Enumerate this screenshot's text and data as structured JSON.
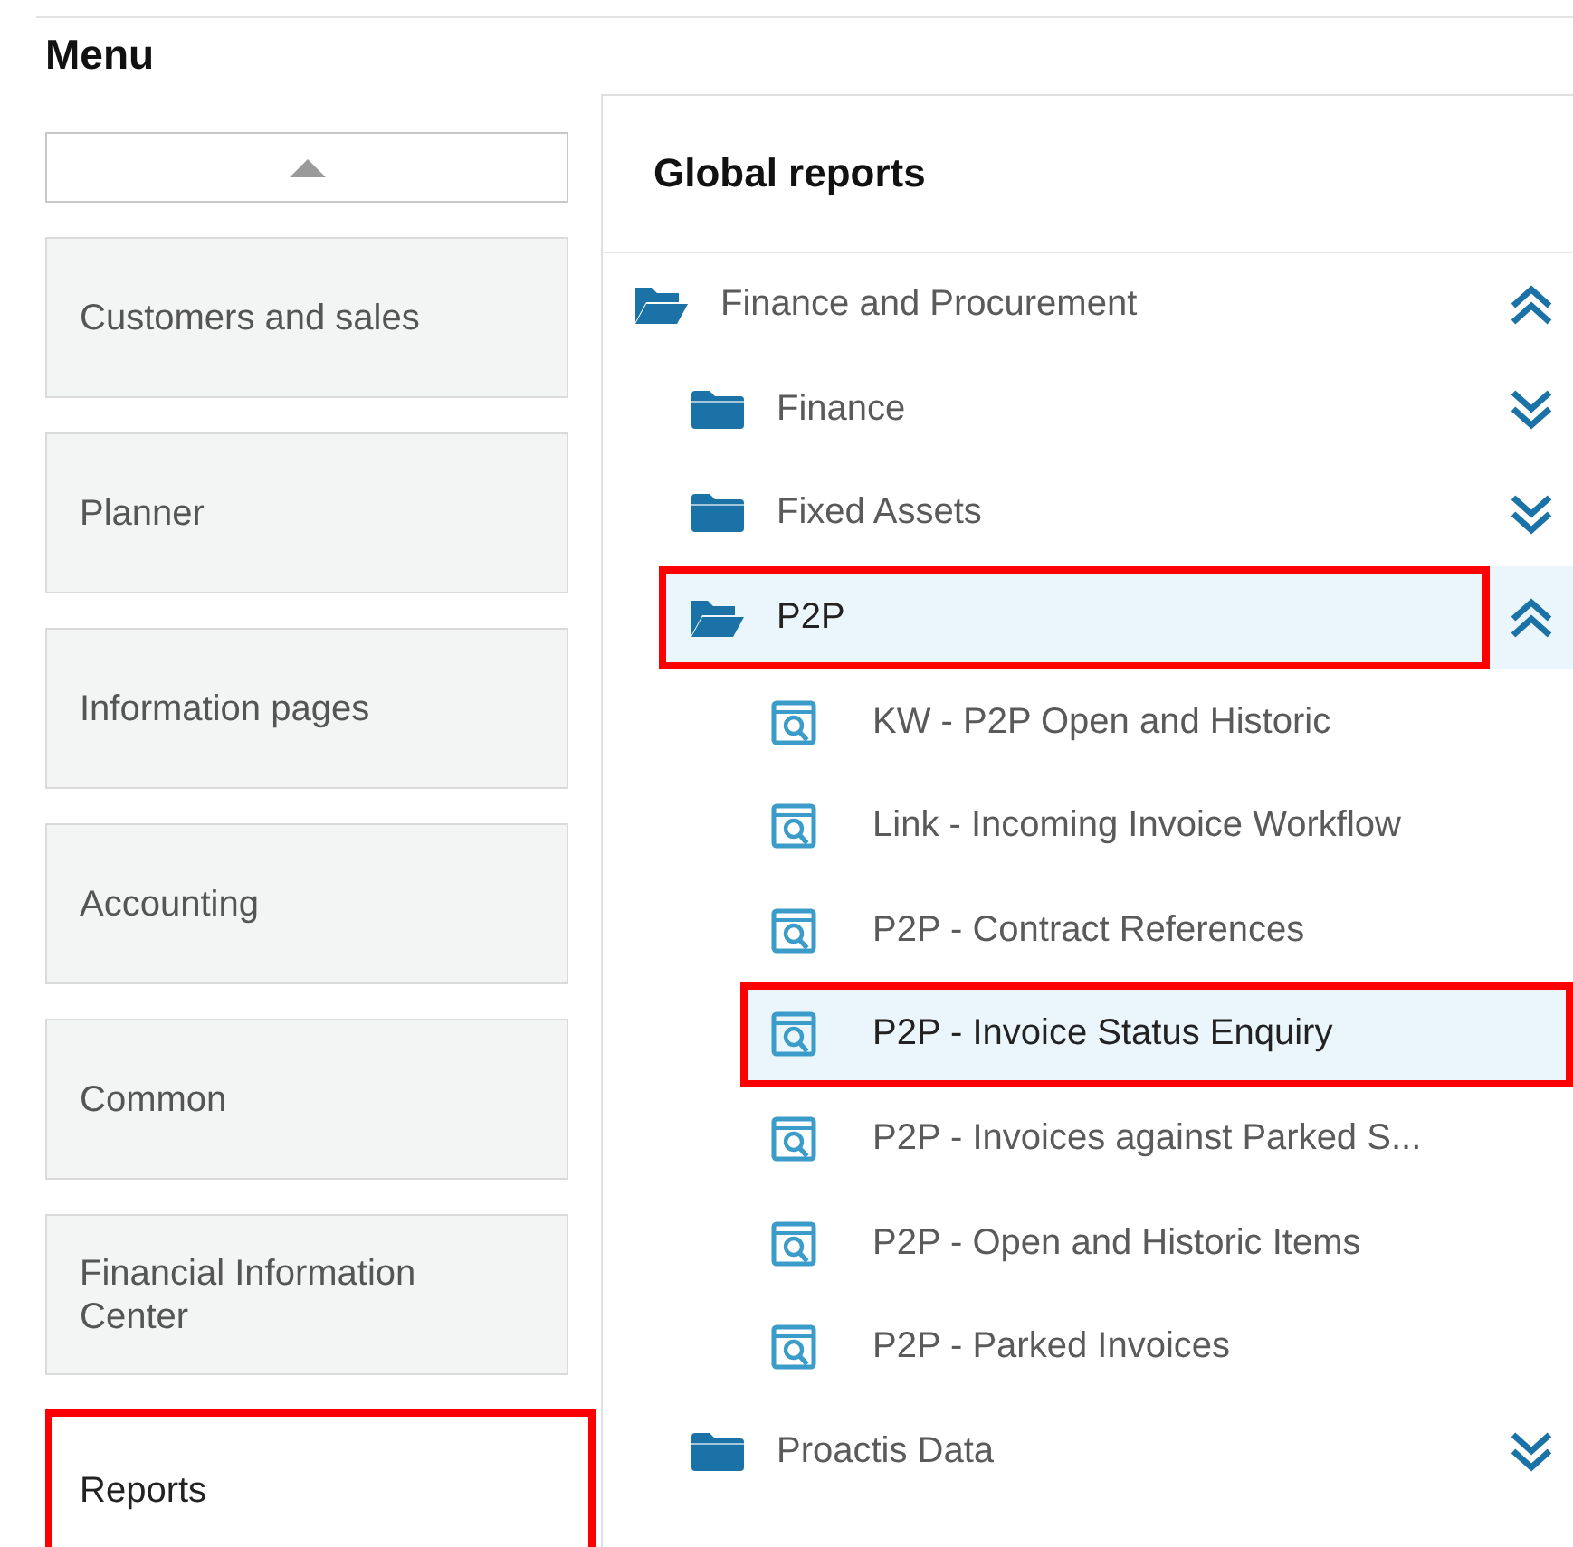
{
  "menu": {
    "title": "Menu",
    "scroll_up": true,
    "items": [
      {
        "label": "Customers and sales",
        "selected": false,
        "highlighted": false
      },
      {
        "label": "Planner",
        "selected": false,
        "highlighted": false
      },
      {
        "label": "Information pages",
        "selected": false,
        "highlighted": false
      },
      {
        "label": "Accounting",
        "selected": false,
        "highlighted": false
      },
      {
        "label": "Common",
        "selected": false,
        "highlighted": false
      },
      {
        "label": "Financial Information Center",
        "selected": false,
        "highlighted": false
      },
      {
        "label": "Reports",
        "selected": true,
        "highlighted": true
      }
    ]
  },
  "panel": {
    "title": "Global reports",
    "tree": [
      {
        "label": "Finance and Procurement",
        "kind": "folder",
        "expanded": true,
        "selected": false,
        "highlighted": false,
        "children": [
          {
            "label": "Finance",
            "kind": "folder",
            "expanded": false,
            "selected": false,
            "highlighted": false
          },
          {
            "label": "Fixed Assets",
            "kind": "folder",
            "expanded": false,
            "selected": false,
            "highlighted": false
          },
          {
            "label": "P2P",
            "kind": "folder",
            "expanded": true,
            "selected": true,
            "highlighted": true,
            "children": [
              {
                "label": "KW - P2P Open and Historic",
                "kind": "report",
                "selected": false,
                "highlighted": false
              },
              {
                "label": "Link - Incoming Invoice Workflow",
                "kind": "report",
                "selected": false,
                "highlighted": false
              },
              {
                "label": "P2P - Contract References",
                "kind": "report",
                "selected": false,
                "highlighted": false
              },
              {
                "label": "P2P - Invoice Status Enquiry",
                "kind": "report",
                "selected": true,
                "highlighted": true
              },
              {
                "label": "P2P - Invoices against Parked S...",
                "kind": "report",
                "selected": false,
                "highlighted": false
              },
              {
                "label": "P2P - Open and Historic Items",
                "kind": "report",
                "selected": false,
                "highlighted": false
              },
              {
                "label": "P2P - Parked Invoices",
                "kind": "report",
                "selected": false,
                "highlighted": false
              }
            ]
          },
          {
            "label": "Proactis Data",
            "kind": "folder",
            "expanded": false,
            "selected": false,
            "highlighted": false
          }
        ]
      }
    ]
  }
}
